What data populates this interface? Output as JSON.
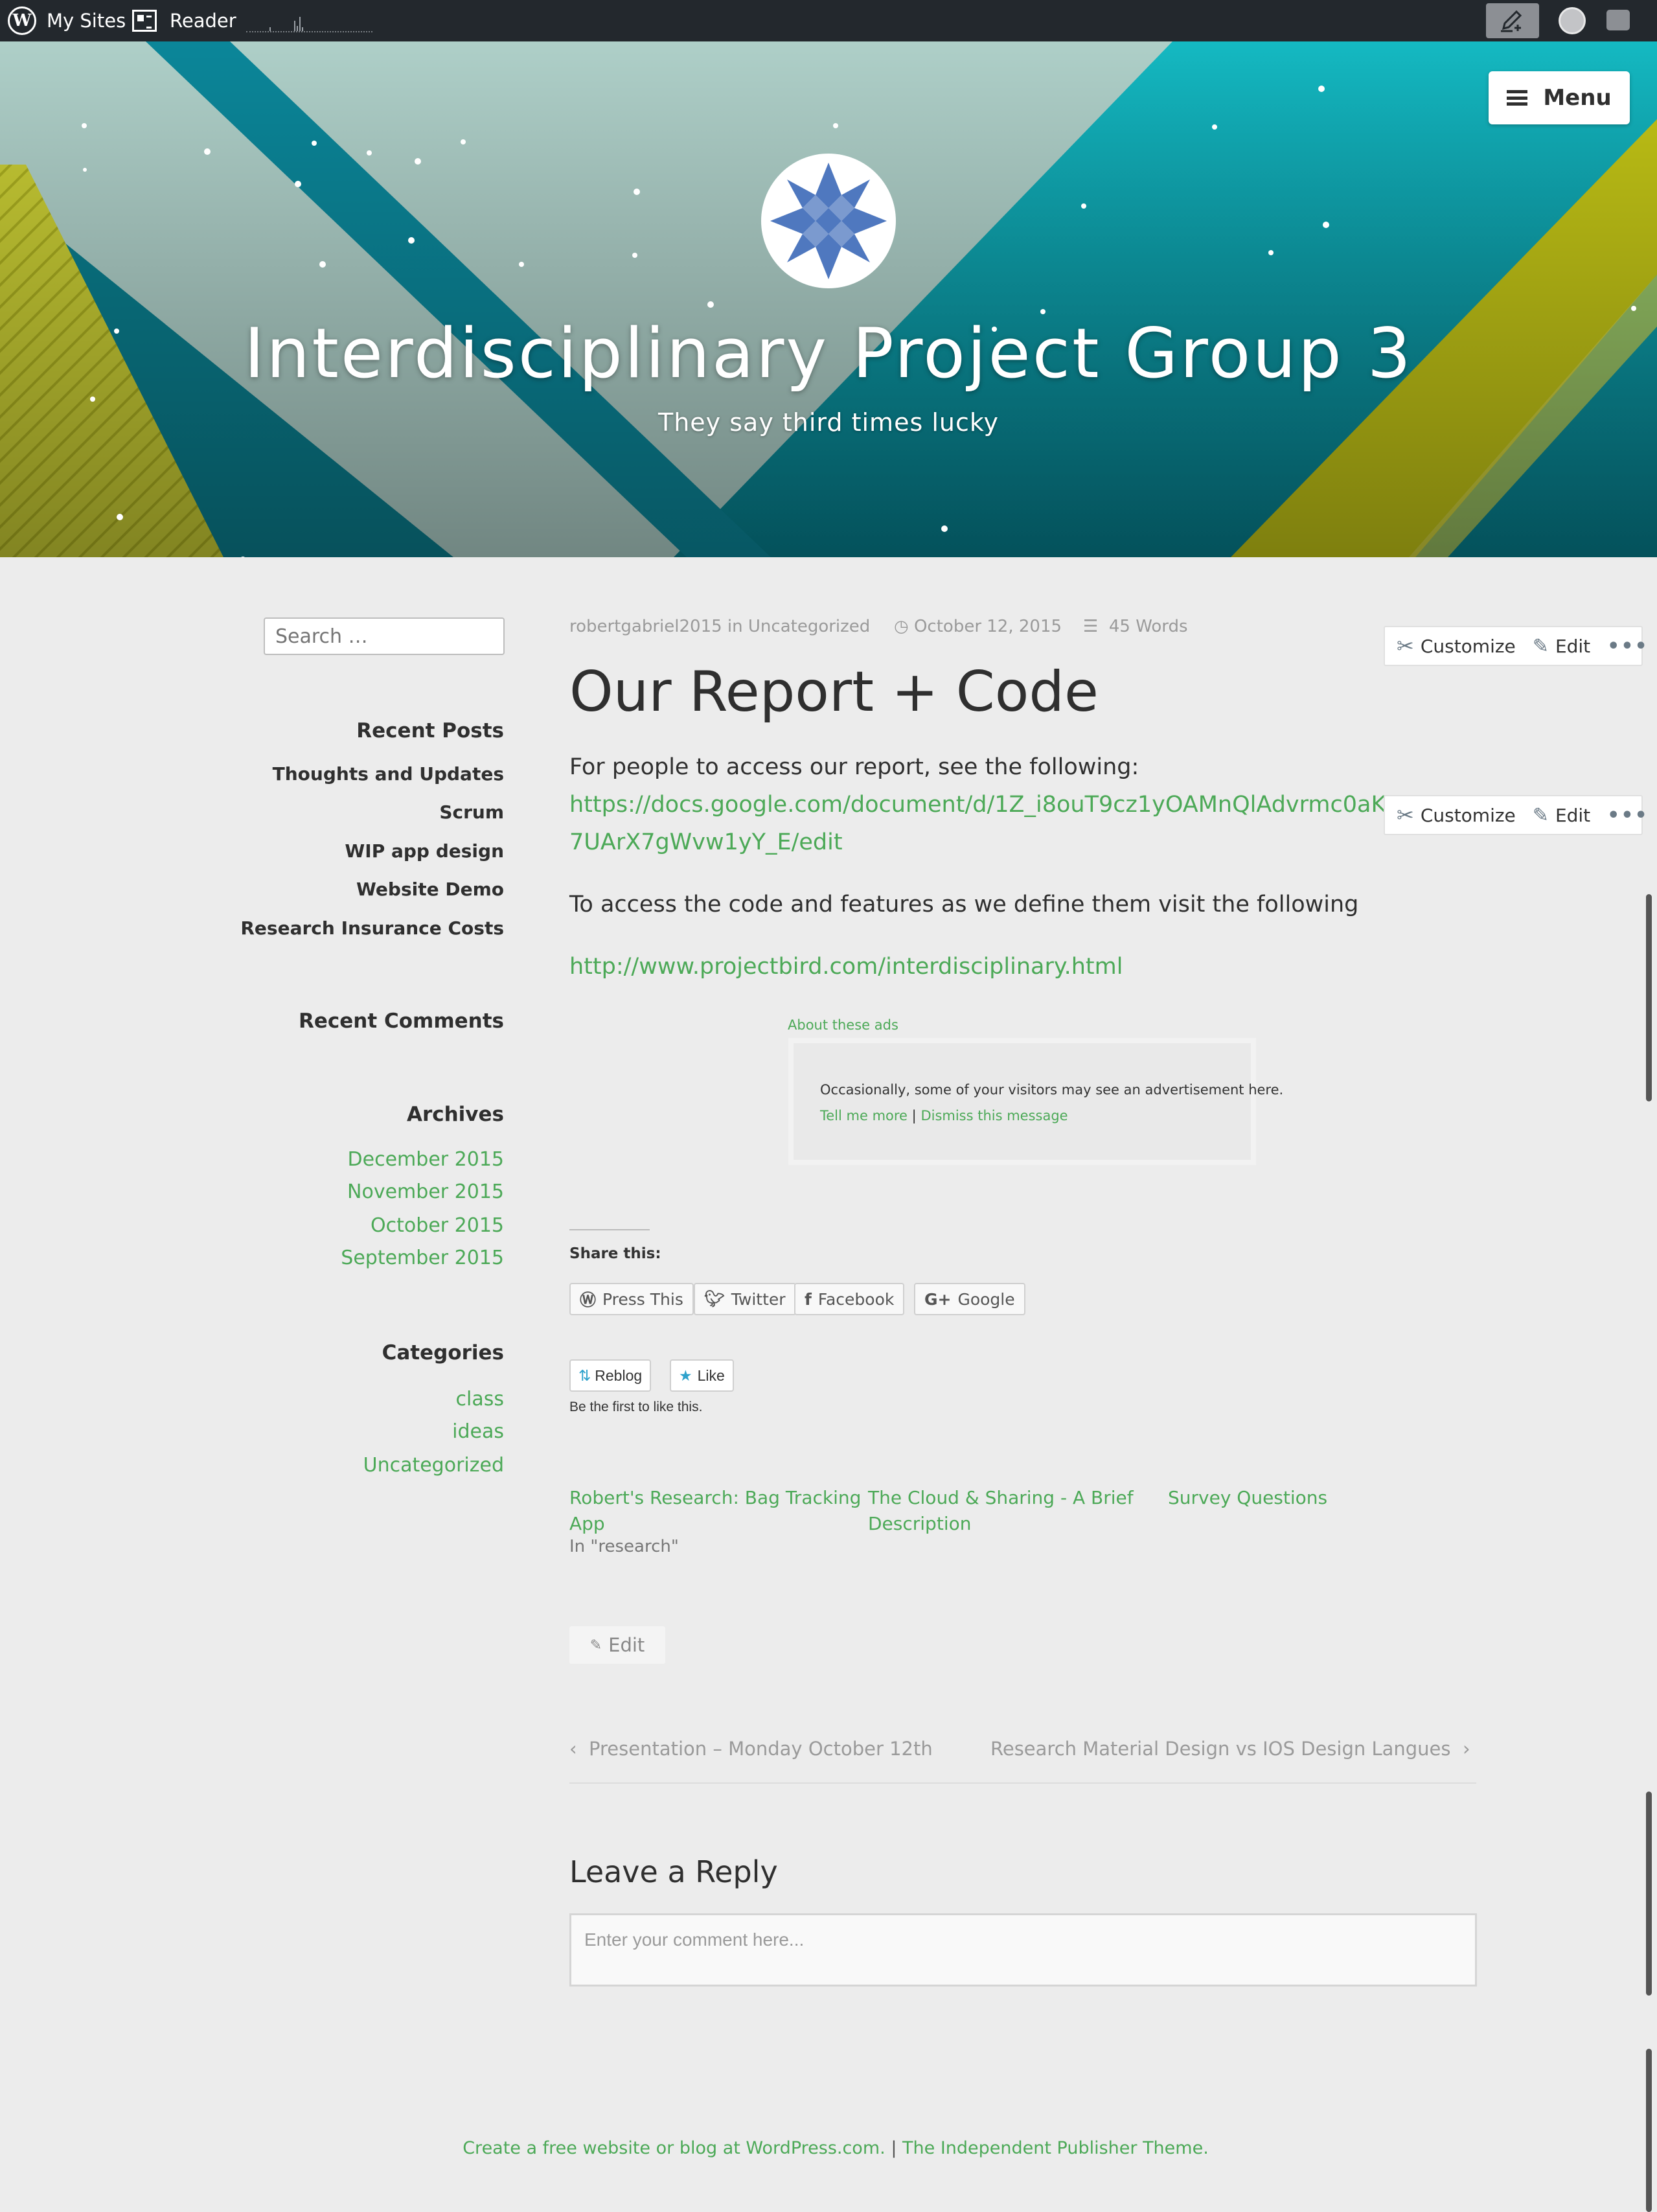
{
  "adminbar": {
    "my_sites": "My Sites",
    "reader": "Reader",
    "write_icon": "pencil-write-icon",
    "avatar_icon": "user-avatar-icon",
    "notifications_icon": "notifications-icon"
  },
  "header": {
    "menu_label": "Menu",
    "site_title": "Interdisciplinary Project Group 3",
    "tagline": "They say third times lucky",
    "colors": {
      "teal": "#0fb3bf",
      "dark_teal": "#007c8b",
      "lime": "#c7cb2f",
      "mint": "#aecfc8"
    }
  },
  "sidebar": {
    "search_placeholder": "Search …",
    "recent_posts_title": "Recent Posts",
    "recent_posts": [
      "Thoughts and Updates",
      "Scrum",
      "WIP app design",
      "Website Demo",
      "Research Insurance Costs"
    ],
    "recent_comments_title": "Recent Comments",
    "archives_title": "Archives",
    "archives": [
      "December 2015",
      "November 2015",
      "October 2015",
      "September 2015"
    ],
    "categories_title": "Categories",
    "categories": [
      "class",
      "ideas",
      "Uncategorized"
    ]
  },
  "post": {
    "author": "robertgabriel2015",
    "in_word": "in",
    "category": "Uncategorized",
    "date": "October 12, 2015",
    "word_count": "45 Words",
    "title": "Our Report + Code",
    "p1": "For people to access our report, see the following:",
    "link1_line1": "https://docs.google.com/document/d/1Z_i8ouT9cz1yOAMnQlAdvrmc0aK",
    "link1_line2": "7UArX7gWvw1yY_E/edit",
    "p2": "To access the code and features as we define them visit the following",
    "link2": "http://www.projectbird.com/interdisciplinary.html"
  },
  "edit_bar": {
    "customize": "Customize",
    "edit": "Edit",
    "more": "•••"
  },
  "ads": {
    "label": "About these ads",
    "message": "Occasionally, some of your visitors may see an advertisement here.",
    "tell_more": "Tell me more",
    "separator": "|",
    "dismiss": "Dismiss this message"
  },
  "share": {
    "title": "Share this:",
    "buttons": [
      "Press This",
      "Twitter",
      "Facebook",
      "Google"
    ]
  },
  "likes": {
    "reblog": "Reblog",
    "like": "Like",
    "note": "Be the first to like this."
  },
  "related": {
    "items": [
      {
        "title": "Robert's Research: Bag Tracking App",
        "line1": "Robert's Research: Bag Tracking",
        "line2": "App",
        "context": "In \"research\""
      },
      {
        "title": "The Cloud & Sharing - A Brief Description",
        "line1": "The Cloud & Sharing - A Brief",
        "line2": "Description"
      },
      {
        "title": "Survey Questions",
        "line1": "Survey Questions"
      }
    ]
  },
  "edit_link": "Edit",
  "nav": {
    "prev": "Presentation – Monday October 12th",
    "next": "Research Material Design vs IOS Design Langues"
  },
  "reply": {
    "title": "Leave a Reply",
    "placeholder": "Enter your comment here..."
  },
  "footer": {
    "create_link": "Create a free website or blog at WordPress.com.",
    "separator": "|",
    "theme_link": "The Independent Publisher Theme."
  }
}
